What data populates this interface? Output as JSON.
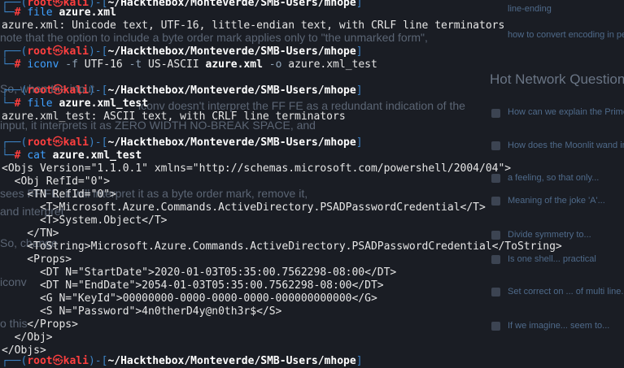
{
  "background_page": {
    "lines": [
      {
        "text": "note that the option to include a byte order mark applies only to \"the unmarked form\","
      },
      {
        "text": "So, when the input"
      },
      {
        "text": "iconv doesn't interpret the FF FE as a redundant indication of the"
      },
      {
        "text": "input, it interprets it as ZERO WIDTH NO-BREAK SPACE, and"
      },
      {
        "text": "sees FF FE, it will interpret it as a byte order mark, remove it,"
      },
      {
        "text": "and interpret"
      },
      {
        "text": "So, change"
      },
      {
        "text": "iconv"
      },
      {
        "text": "o this"
      }
    ],
    "sidebar": {
      "top_items": [
        "line-ending",
        "how to convert encoding in perl?"
      ],
      "heading": "Hot Network Questions",
      "items": [
        "How can we explain the Prime in Cry...",
        "How does the Moonlit wand interact...",
        "a feeling, so that only...",
        "Meaning of the joke 'A'...",
        "Divide symmetry to...",
        "Is one shell... practical",
        "Set correct on ... of multi line...",
        "If we imagine... seem to..."
      ]
    }
  },
  "prompt": {
    "user": "root",
    "skull": "㉿",
    "host": "kali",
    "cwd": "~/Hackthebox/Monteverde/SMB-Users/mhope",
    "symbol": "#"
  },
  "commands": [
    {
      "cmd": "file",
      "args": "azure.xml"
    },
    {
      "cmd": "iconv",
      "args": "-f UTF-16 -t US-ASCII azure.xml -o azure.xml_test"
    },
    {
      "cmd": "file",
      "args": "azure.xml_test"
    },
    {
      "cmd": "cat",
      "args": "azure.xml_test"
    }
  ],
  "outputs": {
    "file1": "azure.xml: Unicode text, UTF-16, little-endian text, with CRLF line terminators",
    "file2": "azure.xml_test: ASCII text, with CRLF line terminators",
    "xml_lines": [
      "<Objs Version=\"1.1.0.1\" xmlns=\"http://schemas.microsoft.com/powershell/2004/04\">",
      "  <Obj RefId=\"0\">",
      "    <TN RefId=\"0\">",
      "      <T>Microsoft.Azure.Commands.ActiveDirectory.PSADPasswordCredential</T>",
      "      <T>System.Object</T>",
      "    </TN>",
      "    <ToString>Microsoft.Azure.Commands.ActiveDirectory.PSADPasswordCredential</ToString>",
      "    <Props>",
      "      <DT N=\"StartDate\">2020-01-03T05:35:00.7562298-08:00</DT>",
      "      <DT N=\"EndDate\">2054-01-03T05:35:00.7562298-08:00</DT>",
      "      <G N=\"KeyId\">00000000-0000-0000-0000-000000000000</G>",
      "      <S N=\"Password\">4n0therD4y@n0th3r$</S>",
      "    </Props>",
      "  </Obj>",
      "</Objs>"
    ]
  },
  "iconv_parts": {
    "f_flag": "-f",
    "from": "UTF-16",
    "t_flag": "-t",
    "to": "US-ASCII",
    "input": "azure.xml",
    "o_flag": "-o",
    "output": "azure.xml_test"
  }
}
